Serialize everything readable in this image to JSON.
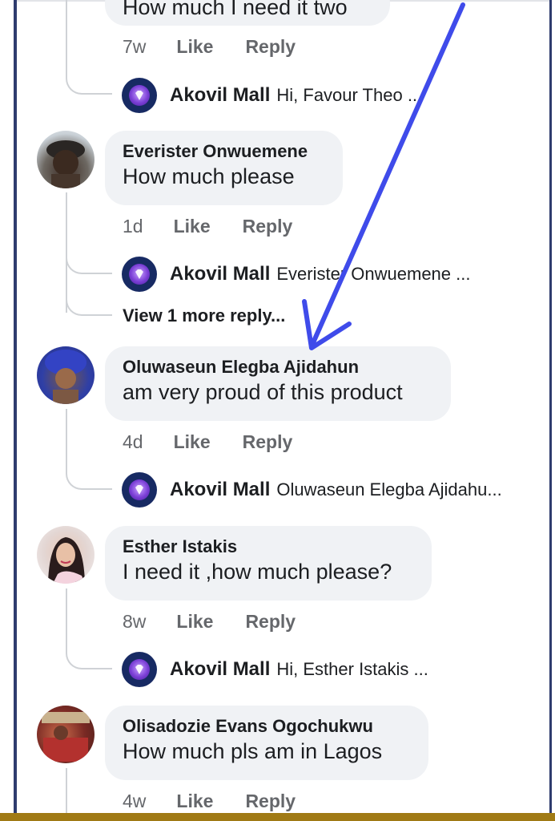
{
  "colors": {
    "bubble": "#f0f2f5",
    "meta_text": "#65676b",
    "arrow": "#3f4bea",
    "brand_logo": "#172a63"
  },
  "partial_comment": {
    "text": "How much I need it two",
    "time": "7w",
    "like": "Like",
    "reply": "Reply",
    "reply_preview": {
      "author": "Akovil Mall",
      "text": "Hi, Favour Theo ..."
    }
  },
  "comments": [
    {
      "author": "Everister Onwuemene",
      "text": "How much please",
      "time": "1d",
      "like": "Like",
      "reply": "Reply",
      "reply_preview": {
        "author": "Akovil Mall",
        "text": "Everister Onwuemene ..."
      },
      "more_replies": "View 1 more reply..."
    },
    {
      "author": "Oluwaseun Elegba Ajidahun",
      "text": "am very proud of this product",
      "time": "4d",
      "like": "Like",
      "reply": "Reply",
      "reply_preview": {
        "author": "Akovil Mall",
        "text": "Oluwaseun Elegba Ajidahu..."
      }
    },
    {
      "author": "Esther Istakis",
      "text": "I need it ,how much please?",
      "time": "8w",
      "like": "Like",
      "reply": "Reply",
      "reply_preview": {
        "author": "Akovil Mall",
        "text": "Hi, Esther Istakis ..."
      }
    },
    {
      "author": "Olisadozie Evans Ogochukwu",
      "text": "How much pls am in Lagos",
      "time": "4w",
      "like": "Like",
      "reply": "Reply"
    }
  ]
}
